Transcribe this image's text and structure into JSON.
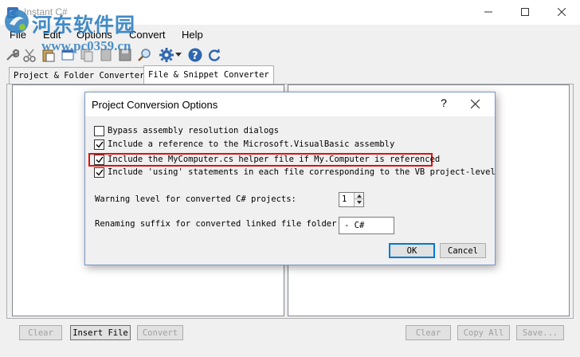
{
  "window": {
    "title": "Instant C#"
  },
  "watermark": {
    "text_cn": "河东软件园",
    "url": "www.pc0359.cn"
  },
  "menu": [
    "File",
    "Edit",
    "Options",
    "Convert",
    "Help"
  ],
  "toolbar": {
    "icons": [
      "wrench-icon",
      "scissors-icon",
      "paste-icon",
      "open-icon",
      "copy-icon",
      "save-icon",
      "search-icon",
      "gear-icon",
      "help-icon",
      "refresh-icon"
    ]
  },
  "tabs": [
    {
      "label": "Project & Folder Converter",
      "active": false
    },
    {
      "label": "File & Snippet Converter",
      "active": true
    }
  ],
  "bottom_buttons": {
    "left_clear": "Clear",
    "insert_file": "Insert File",
    "convert": "Convert",
    "right_clear": "Clear",
    "copy_all": "Copy All",
    "save": "Save..."
  },
  "dialog": {
    "title": "Project Conversion Options",
    "help_glyph": "?",
    "options": [
      {
        "label": "Bypass assembly resolution dialogs",
        "checked": false
      },
      {
        "label": "Include a reference to the Microsoft.VisualBasic assembly",
        "checked": true
      },
      {
        "label": "Include the MyComputer.cs helper file if My.Computer is referenced",
        "checked": true
      },
      {
        "label": "Include 'using' statements in each file corresponding to the VB project-level",
        "checked": true
      }
    ],
    "warning_label": "Warning level for converted C# projects:",
    "warning_value": "1",
    "suffix_label": "Renaming suffix for converted linked file folder",
    "suffix_value": "- C#",
    "ok": "OK",
    "cancel": "Cancel"
  },
  "colors": {
    "highlight": "#e01010",
    "accent": "#0078d7",
    "watermark": "#2f7fc1"
  }
}
